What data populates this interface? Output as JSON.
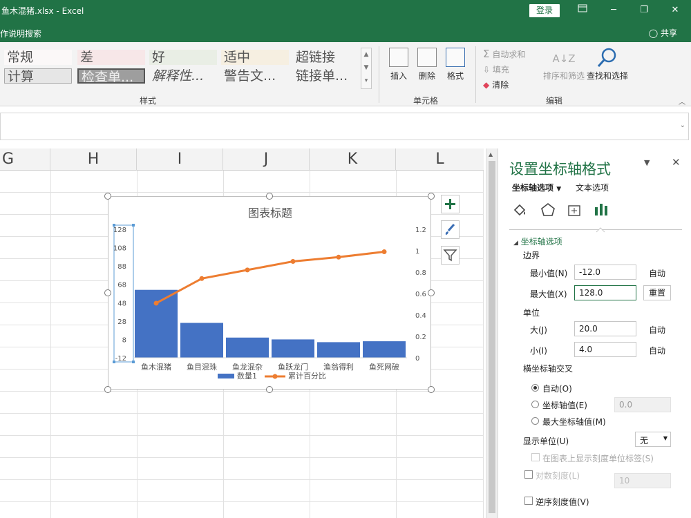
{
  "titlebar": {
    "title": "鱼木混猪.xlsx  -  Excel",
    "login": "登录",
    "tell_me": "作说明搜索",
    "share": "共享"
  },
  "ribbon": {
    "styles": {
      "row1": [
        "常规",
        "差",
        "好",
        "适中",
        "超链接"
      ],
      "row2": [
        "计算",
        "检查单...",
        "解释性...",
        "警告文...",
        "链接单..."
      ],
      "label": "样式"
    },
    "cells": {
      "insert": "插入",
      "delete": "删除",
      "format": "格式",
      "label": "单元格"
    },
    "edit": {
      "autosum": "自动求和",
      "fill": "填充",
      "clear": "清除",
      "sort_filter": "排序和筛选",
      "find_select": "查找和选择",
      "label": "编辑"
    }
  },
  "grid": {
    "columns": [
      "G",
      "H",
      "I",
      "J",
      "K",
      "L"
    ]
  },
  "chart_data": {
    "type": "bar",
    "title": "图表标题",
    "categories": [
      "鱼木混猪",
      "鱼目混珠",
      "鱼龙混杂",
      "鱼跃龙门",
      "渔翁得利",
      "鱼死网破"
    ],
    "series": [
      {
        "name": "数量1",
        "type": "bar",
        "axis": "primary",
        "color": "#4472c4",
        "values": [
          62,
          26,
          10,
          8,
          5,
          6
        ]
      },
      {
        "name": "累计百分比",
        "type": "line",
        "axis": "secondary",
        "color": "#ed7d31",
        "values": [
          0.51,
          0.74,
          0.82,
          0.9,
          0.94,
          0.99
        ]
      }
    ],
    "y_primary": {
      "min": -12,
      "max": 128,
      "ticks": [
        "128",
        "108",
        "88",
        "68",
        "48",
        "28",
        "8",
        "-12"
      ]
    },
    "y_secondary": {
      "min": 0,
      "max": 1.2,
      "ticks": [
        "1.2",
        "1",
        "0.8",
        "0.6",
        "0.4",
        "0.2",
        "0"
      ]
    },
    "legend": "bottom",
    "grid": false
  },
  "pane": {
    "title": "设置坐标轴格式",
    "tab_axis": "坐标轴选项",
    "tab_text": "文本选项",
    "section": "坐标轴选项",
    "bounds": "边界",
    "min_label": "最小值(N)",
    "min_value": "-12.0",
    "min_auto": "自动",
    "max_label": "最大值(X)",
    "max_value": "128.0",
    "max_reset": "重置",
    "units": "单位",
    "major_label": "大(J)",
    "major_value": "20.0",
    "major_auto": "自动",
    "minor_label": "小(I)",
    "minor_value": "4.0",
    "minor_auto": "自动",
    "cross": "横坐标轴交叉",
    "radio_auto": "自动(O)",
    "radio_axis_value": "坐标轴值(E)",
    "axis_value": "0.0",
    "radio_max": "最大坐标轴值(M)",
    "display_units": "显示单位(U)",
    "display_units_value": "无",
    "show_label": "在图表上显示刻度单位标签(S)",
    "log_scale": "对数刻度(L)",
    "log_base": "10",
    "reverse": "逆序刻度值(V)"
  },
  "colors": {
    "accent": "#217346",
    "bar": "#4472c4",
    "line": "#ed7d31"
  }
}
